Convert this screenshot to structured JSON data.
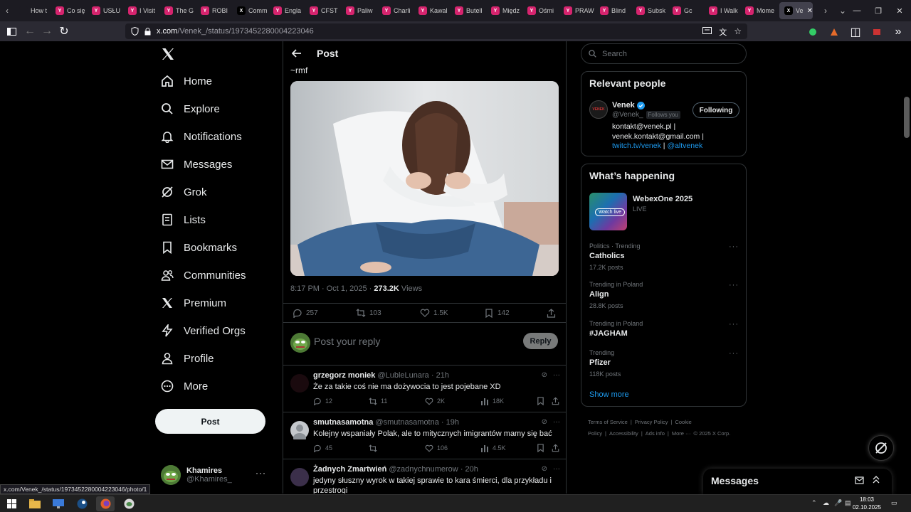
{
  "browser": {
    "tabs": [
      {
        "title": "How t",
        "favicon_color": "#1c1b22",
        "favicon_glyph": ""
      },
      {
        "title": "Co się",
        "favicon_color": "#d6246e",
        "favicon_glyph": "Y"
      },
      {
        "title": "USŁU",
        "favicon_color": "#d6246e",
        "favicon_glyph": "Y"
      },
      {
        "title": "I Visit",
        "favicon_color": "#d6246e",
        "favicon_glyph": "Y"
      },
      {
        "title": "The G",
        "favicon_color": "#d6246e",
        "favicon_glyph": "Y"
      },
      {
        "title": "ROBI",
        "favicon_color": "#d6246e",
        "favicon_glyph": "Y"
      },
      {
        "title": "Comm",
        "favicon_color": "#000000",
        "favicon_glyph": "X"
      },
      {
        "title": "Engla",
        "favicon_color": "#d6246e",
        "favicon_glyph": "Y"
      },
      {
        "title": "CFST",
        "favicon_color": "#d6246e",
        "favicon_glyph": "Y"
      },
      {
        "title": "Paliw",
        "favicon_color": "#d6246e",
        "favicon_glyph": "Y"
      },
      {
        "title": "Charli",
        "favicon_color": "#d6246e",
        "favicon_glyph": "Y"
      },
      {
        "title": "Kawal",
        "favicon_color": "#d6246e",
        "favicon_glyph": "Y"
      },
      {
        "title": "Butell",
        "favicon_color": "#d6246e",
        "favicon_glyph": "Y"
      },
      {
        "title": "Międz",
        "favicon_color": "#d6246e",
        "favicon_glyph": "Y"
      },
      {
        "title": "Ośmi",
        "favicon_color": "#d6246e",
        "favicon_glyph": "Y"
      },
      {
        "title": "PRAW",
        "favicon_color": "#d6246e",
        "favicon_glyph": "Y"
      },
      {
        "title": "Blind",
        "favicon_color": "#d6246e",
        "favicon_glyph": "Y"
      },
      {
        "title": "Subsk",
        "favicon_color": "#d6246e",
        "favicon_glyph": "Y"
      },
      {
        "title": "Gc",
        "favicon_color": "#d6246e",
        "favicon_glyph": "Y"
      },
      {
        "title": "I Walk",
        "favicon_color": "#d6246e",
        "favicon_glyph": "Y"
      },
      {
        "title": "Mome",
        "favicon_color": "#d6246e",
        "favicon_glyph": "Y"
      }
    ],
    "active_tab": {
      "title": "Ven",
      "favicon_glyph": "X"
    },
    "url_host": "x.com",
    "url_path": "/Venek_/status/1973452280004223046",
    "status_url": "x.com/Venek_/status/1973452280004223046/photo/1"
  },
  "nav": {
    "items": [
      {
        "label": "Home",
        "icon": "home-icon"
      },
      {
        "label": "Explore",
        "icon": "search-icon"
      },
      {
        "label": "Notifications",
        "icon": "bell-icon"
      },
      {
        "label": "Messages",
        "icon": "envelope-icon"
      },
      {
        "label": "Grok",
        "icon": "grok-icon"
      },
      {
        "label": "Lists",
        "icon": "list-icon"
      },
      {
        "label": "Bookmarks",
        "icon": "bookmark-icon"
      },
      {
        "label": "Communities",
        "icon": "people-icon"
      },
      {
        "label": "Premium",
        "icon": "x-logo-icon"
      },
      {
        "label": "Verified Orgs",
        "icon": "lightning-icon"
      },
      {
        "label": "Profile",
        "icon": "person-icon"
      },
      {
        "label": "More",
        "icon": "more-circle-icon"
      }
    ],
    "post_label": "Post",
    "account": {
      "name": "Khamires",
      "handle": "@Khamires_"
    }
  },
  "post": {
    "header_title": "Post",
    "tail_text": "~rmf",
    "time": "8:17 PM · Oct 1, 2025 · ",
    "views_count": "273.2K",
    "views_label": " Views",
    "stats": {
      "replies": "257",
      "reposts": "103",
      "likes": "1.5K",
      "bookmarks": "142"
    },
    "reply_placeholder": "Post your reply",
    "reply_button": "Reply"
  },
  "comments": [
    {
      "name": "grzegorz moniek",
      "handle": "@LubleLunara",
      "time": "· 21h",
      "text": "Że za takie coś nie ma dożywocia to jest pojebane XD",
      "replies": "12",
      "reposts": "11",
      "likes": "2K",
      "views": "18K"
    },
    {
      "name": "smutnasamotna",
      "handle": "@smutnasamotna",
      "time": "· 19h",
      "text": "Kolejny wspaniały Polak, ale to mitycznych imigrantów mamy się bać",
      "replies": "45",
      "reposts": "",
      "likes": "106",
      "views": "4.5K"
    },
    {
      "name": "Żadnych Zmartwień",
      "handle": "@zadnychnumerow",
      "time": "· 20h",
      "text": "jedyny słuszny wyrok w takiej sprawie to kara śmierci, dla przykładu i przestrogi"
    }
  ],
  "sidebar": {
    "search_placeholder": "Search",
    "relevant": {
      "title": "Relevant people",
      "name": "Venek",
      "handle": "@Venek_",
      "follows_you": "Follows you",
      "follow_button": "Following",
      "avatar_text": "VENEK",
      "bio_1": "kontakt@venek.pl | venek.kontakt@gmail.com | ",
      "bio_link_1": "twitch.tv/venek",
      "bio_2": " | ",
      "bio_link_2": "@altvenek"
    },
    "happening": {
      "title": "What’s happening",
      "event_title": "WebexOne 2025",
      "event_sub": "LIVE",
      "event_badge": "Watch live",
      "trends": [
        {
          "context": "Politics · Trending",
          "name": "Catholics",
          "count": "17.2K posts"
        },
        {
          "context": "Trending in Poland",
          "name": "Align",
          "count": "28.8K posts"
        },
        {
          "context": "Trending in Poland",
          "name": "#JAGHAM",
          "count": ""
        },
        {
          "context": "Trending",
          "name": "Pfizer",
          "count": "118K posts"
        }
      ],
      "show_more": "Show more"
    },
    "footer": [
      "Terms of Service",
      "|",
      "Privacy Policy",
      "|",
      "Cookie Policy",
      "|",
      "Accessibility",
      "|",
      "Ads info",
      "|",
      "More ···",
      "© 2025 X Corp."
    ]
  },
  "messages_drawer": {
    "title": "Messages"
  },
  "taskbar": {
    "time": "18:03",
    "date": "02.10.2025"
  },
  "colors": {
    "accent": "#1d9bf0",
    "bg": "#000000",
    "border": "#2f3336",
    "muted": "#71767b"
  }
}
